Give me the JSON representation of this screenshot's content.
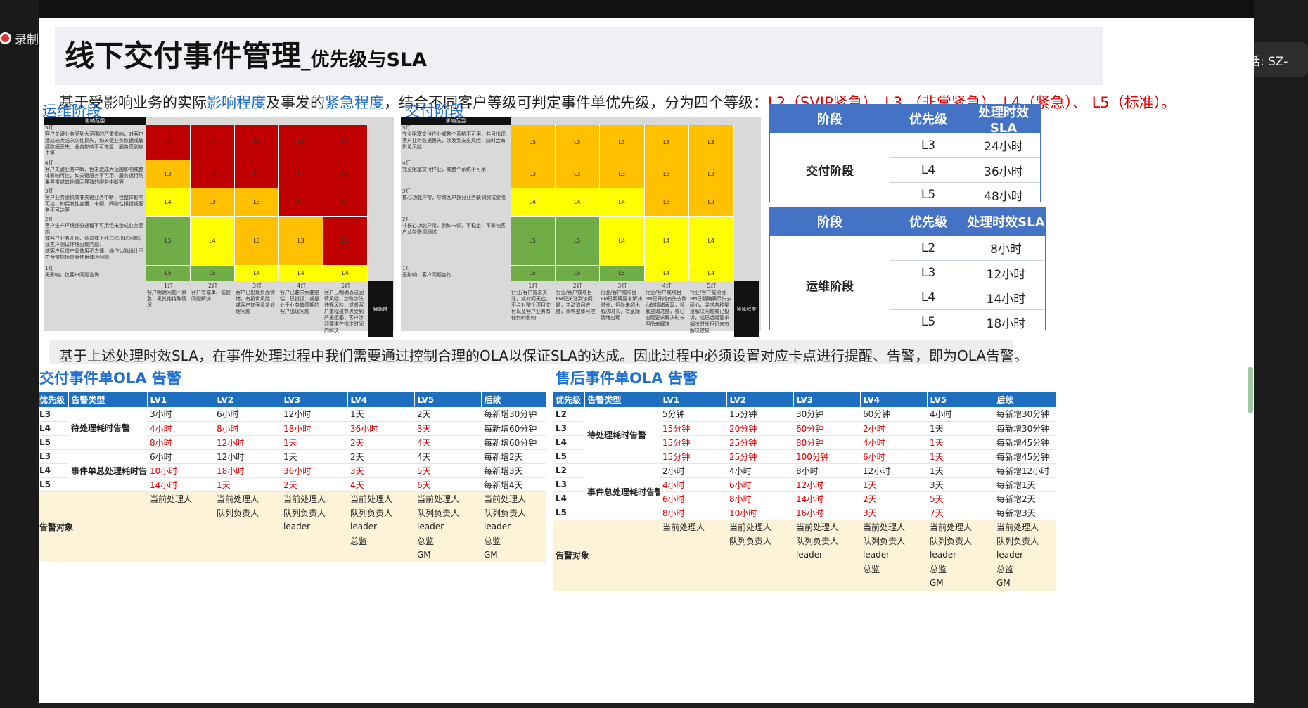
{
  "meeting": {
    "recording_label": "录制中",
    "speaker_label": "正在讲话: SZ-"
  },
  "slide": {
    "title_main": "线下交付事件管理",
    "title_sub": "_优先级与SLA",
    "intro": {
      "p1": "基于受影响业务的实际",
      "h1": "影响程度",
      "p2": "及事发的",
      "h2": "紧急程度",
      "p3": "，结合不同客户等级可判定事件单优先级，分为四个等级：",
      "levels": "L2（SVIP紧急）、L3 （非常紧急）、L4（紧急）、 L5（标准）。"
    },
    "ops_label": "运维阶段",
    "delivery_label": "交付阶段",
    "matrix_ops": {
      "header": "影响范围",
      "rows": [
        {
          "desc": "5灯\n客户关键业务受到大范围的严重影响，对客户造成较大或永久性损失，如关键业务数据或敏感数据丢失、业务影响不可恢复，服务受到攻击等",
          "cells": [
            "L2",
            "L2",
            "L2",
            "L2",
            "L2"
          ]
        },
        {
          "desc": "4灯\n客户关键业务中断，但未造成大范围影响或整体影响可控，如关键服务不可用、服务运行结果异常或其他原因导致的服务中断等",
          "cells": [
            "L3",
            "L2",
            "L2",
            "L2",
            "L2"
          ]
        },
        {
          "desc": "3灯\n客户业务受损或非关键业务中断，但整体影响可控，如偶发性变慢、卡顿、间歇性报错或服务不可达等",
          "cells": [
            "L4",
            "L3",
            "L3",
            "L2",
            "L2"
          ]
        },
        {
          "desc": "2灯\n客户生产环境部分通程不可用但未造成业务受损；\n或客户业务开发、调试或上线过程出现问题；\n或客户测试环境出现问题；\n或客户反馈产品使用不方便，操作功能设计不符合常规场景等使用体验问题",
          "cells": [
            "L5",
            "L4",
            "L3",
            "L3",
            "L2"
          ]
        },
        {
          "desc": "1灯\n无影响，仅客户问题咨询",
          "cells": [
            "L5",
            "L5",
            "L4",
            "L4",
            "L4"
          ]
        }
      ],
      "axis": [
        "1灯",
        "2灯",
        "3灯",
        "4灯",
        "5灯"
      ],
      "axis_desc": [
        "客户明确问题不紧急、无其他特殊情况",
        "客户有催单、催促问题解决",
        "客户已出现负面情绪，有投诉风险；或客户加强紧急处理问题",
        "客户已要求索要赔偿、已投诉；或是处于业务敏感期的客户出现问题",
        "客户已明确表达因情风险、涉政涉法违规风险；或者客户重程碰节点受到严重阻塞；客户涉罚要求在指定时间内解决"
      ],
      "urgency_label": "紧急度"
    },
    "matrix_delivery": {
      "header": "影响范围",
      "rows": [
        {
          "desc": "5灯\n完全阻塞交付作业或整个系统不可用，并且出现客户业务数据丢失，涉及到安全风险，随时会有舆论风险",
          "cells": [
            "L3",
            "L3",
            "L3",
            "L3",
            "L3"
          ]
        },
        {
          "desc": "4灯\n完全阻塞交付作业，或整个系统不可用",
          "cells": [
            "L3",
            "L3",
            "L3",
            "L3",
            "L3"
          ]
        },
        {
          "desc": "3灯\n核心功能异常，导致客户部分业务联调测试受阻",
          "cells": [
            "L4",
            "L4",
            "L4",
            "L3",
            "L3"
          ]
        },
        {
          "desc": "2灯\n非核心功能异常，例如卡顿，不稳定，不影响客户业务联调测试",
          "cells": [
            "L5",
            "L5",
            "L4",
            "L4",
            "L4"
          ]
        },
        {
          "desc": "1灯\n无影响，客户问题咨询",
          "cells": [
            "L5",
            "L5",
            "L5",
            "L4",
            "L4"
          ]
        }
      ],
      "axis": [
        "1灯",
        "2灯",
        "3灯",
        "4灯",
        "5灯"
      ],
      "axis_desc": [
        "行业/客户暂未关注，或对问无症，不会对整个项目交付以及客户业务有任何的影响",
        "行业/客户或项目PM已关注到该问题，主动询问进度，事件整体可控",
        "行业/客户或项目PM已明确要求解决时长，但尚未超出解决时长，有急躁情绪出现",
        "行业/客户或项目PM已开始有失去耐心的情绪表现，频繁咨询进度，或已出现要求解决时长但仍未解决",
        "行业/客户或项目PM已明确表示失去耐心，寻求各种渠道解决问题或已投诉，或已远超要求解决时长但仍未有解决迹象"
      ],
      "urgency_label": "紧急程度"
    },
    "sla_tables": [
      {
        "headers": [
          "阶段",
          "优先级",
          "处理时效SLA"
        ],
        "stage": "交付阶段",
        "rows": [
          [
            "L3",
            "24小时"
          ],
          [
            "L4",
            "36小时"
          ],
          [
            "L5",
            "48小时"
          ]
        ]
      },
      {
        "headers": [
          "阶段",
          "优先级",
          "处理时效SLA"
        ],
        "stage": "运维阶段",
        "rows": [
          [
            "L2",
            "8小时"
          ],
          [
            "L3",
            "12小时"
          ],
          [
            "L4",
            "14小时"
          ],
          [
            "L5",
            "18小时"
          ]
        ]
      }
    ],
    "middle_text": "基于上述处理时效SLA，在事件处理过程中我们需要通过控制合理的OLA以保证SLA的达成。因此过程中必须设置对应卡点进行提醒、告警，即为OLA告警。",
    "ola_delivery": {
      "title": "交付事件单OLA 告警",
      "headers": [
        "优先级",
        "告警类型",
        "LV1",
        "LV2",
        "LV3",
        "LV4",
        "LV5",
        "后续"
      ],
      "group1": "待处理耗时告警",
      "group2": "事件单总处理耗时告警",
      "rows": [
        [
          "L3",
          "3小时",
          "6小时",
          "12小时",
          "1天",
          "2天",
          "每新增30分钟"
        ],
        [
          "L4",
          "4小时",
          "8小时",
          "18小时",
          "36小时",
          "3天",
          "每新增60分钟"
        ],
        [
          "L5",
          "8小时",
          "12小时",
          "1天",
          "2天",
          "4天",
          "每新增60分钟"
        ],
        [
          "L3",
          "6小时",
          "12小时",
          "1天",
          "2天",
          "4天",
          "每新增2天"
        ],
        [
          "L4",
          "10小时",
          "18小时",
          "36小时",
          "3天",
          "5天",
          "每新增3天"
        ],
        [
          "L5",
          "14小时",
          "1天",
          "2天",
          "4天",
          "6天",
          "每新增4天"
        ]
      ],
      "target_label": "告警对象",
      "targets": [
        [
          "当前处理人",
          "当前处理人",
          "当前处理人",
          "当前处理人",
          "当前处理人",
          "当前处理人"
        ],
        [
          "",
          "队列负责人",
          "队列负责人",
          "队列负责人",
          "队列负责人",
          "队列负责人"
        ],
        [
          "",
          "",
          "leader",
          "leader",
          "leader",
          "leader"
        ],
        [
          "",
          "",
          "",
          "总监",
          "总监",
          "总监"
        ],
        [
          "",
          "",
          "",
          "",
          "GM",
          "GM"
        ]
      ]
    },
    "ola_aftersales": {
      "title": "售后事件单OLA 告警",
      "headers": [
        "优先级",
        "告警类型",
        "LV1",
        "LV2",
        "LV3",
        "LV4",
        "LV5",
        "后续"
      ],
      "group1": "待处理耗时告警",
      "group2": "事件总处理耗时告警",
      "rows": [
        [
          "L2",
          "5分钟",
          "15分钟",
          "30分钟",
          "60分钟",
          "4小时",
          "每新增30分钟"
        ],
        [
          "L3",
          "15分钟",
          "20分钟",
          "60分钟",
          "2小时",
          "1天",
          "每新增30分钟"
        ],
        [
          "L4",
          "15分钟",
          "25分钟",
          "80分钟",
          "4小时",
          "1天",
          "每新增45分钟"
        ],
        [
          "L5",
          "15分钟",
          "25分钟",
          "100分钟",
          "6小时",
          "1天",
          "每新增45分钟"
        ],
        [
          "L2",
          "2小时",
          "4小时",
          "8小时",
          "12小时",
          "1天",
          "每新增12小时"
        ],
        [
          "L3",
          "4小时",
          "6小时",
          "12小时",
          "1天",
          "3天",
          "每新增1天"
        ],
        [
          "L4",
          "6小时",
          "8小时",
          "14小时",
          "2天",
          "5天",
          "每新增2天"
        ],
        [
          "L5",
          "8小时",
          "10小时",
          "16小时",
          "3天",
          "7天",
          "每新增3天"
        ]
      ],
      "target_label": "告警对象",
      "targets": [
        [
          "当前处理人",
          "当前处理人",
          "当前处理人",
          "当前处理人",
          "当前处理人",
          "当前处理人"
        ],
        [
          "",
          "队列负责人",
          "队列负责人",
          "队列负责人",
          "队列负责人",
          "队列负责人"
        ],
        [
          "",
          "",
          "leader",
          "leader",
          "leader",
          "leader"
        ],
        [
          "",
          "",
          "",
          "总监",
          "总监",
          "总监"
        ],
        [
          "",
          "",
          "",
          "",
          "GM",
          "GM"
        ]
      ]
    },
    "colors": {
      "accent": "#1f6fd0",
      "alert": "#e00000",
      "table_header": "#1e6fc0",
      "sla_header": "#4472c4"
    }
  }
}
